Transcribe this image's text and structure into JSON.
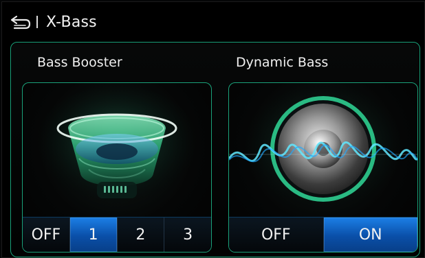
{
  "header": {
    "title": "X-Bass",
    "back_icon": "back-arrow-icon",
    "separator_icon": "separator-bar-icon"
  },
  "bass_booster": {
    "label": "Bass Booster",
    "icon": "subwoofer-green-glow",
    "options": [
      "OFF",
      "1",
      "2",
      "3"
    ],
    "selected": "1"
  },
  "dynamic_bass": {
    "label": "Dynamic Bass",
    "icon": "speaker-waveform",
    "options": [
      "OFF",
      "ON"
    ],
    "selected": "ON"
  },
  "colors": {
    "accent_green": "#1aa27a",
    "active_blue": "#1c7fe6",
    "background": "#000000"
  }
}
